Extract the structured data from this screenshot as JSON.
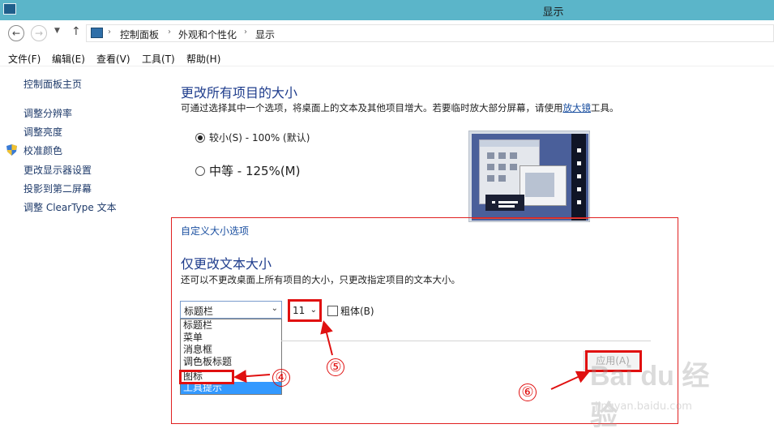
{
  "window": {
    "title": "显示"
  },
  "address": {
    "back_icon": "left-arrow-icon",
    "forward_icon": "right-arrow-icon",
    "up_icon": "up-arrow-icon",
    "crumbs": [
      "控制面板",
      "外观和个性化",
      "显示"
    ],
    "separator": "›"
  },
  "menu": [
    "文件(F)",
    "编辑(E)",
    "查看(V)",
    "工具(T)",
    "帮助(H)"
  ],
  "sidebar": {
    "home": "控制面板主页",
    "items": [
      "调整分辨率",
      "调整亮度",
      "校准颜色",
      "更改显示器设置",
      "投影到第二屏幕",
      "调整 ClearType 文本"
    ]
  },
  "main": {
    "heading": "更改所有项目的大小",
    "description_before": "可通过选择其中一个选项，将桌面上的文本及其他项目增大。若要临时放大部分屏幕，请使用",
    "description_link": "放大镜",
    "description_after": "工具。",
    "options": [
      {
        "label": "较小(S) - 100% (默认)",
        "checked": true
      },
      {
        "label": "中等 - 125%(M)",
        "checked": false
      }
    ]
  },
  "custom": {
    "link": "自定义大小选项",
    "heading": "仅更改文本大小",
    "description": "还可以不更改桌面上所有项目的大小，只更改指定项目的文本大小。",
    "item_select": {
      "value": "标题栏",
      "options": [
        "标题栏",
        "菜单",
        "消息框",
        "调色板标题",
        "图标",
        "工具提示"
      ],
      "highlighted": "工具提示"
    },
    "size_select": {
      "value": "11"
    },
    "bold_label": "粗体(B)",
    "bold_checked": false,
    "apply_label": "应用(A)",
    "apply_enabled": false
  },
  "annotations": {
    "step4": "④",
    "step5": "⑤",
    "step6": "⑥"
  },
  "watermark": {
    "brand": "Bai du 经验",
    "url": "jingyan.baidu.com"
  },
  "colors": {
    "titlebar": "#5bb5c9",
    "heading": "#1e3c8c",
    "link": "#1a4fa0",
    "annotation": "#e01010",
    "list_selection": "#3399ff"
  }
}
